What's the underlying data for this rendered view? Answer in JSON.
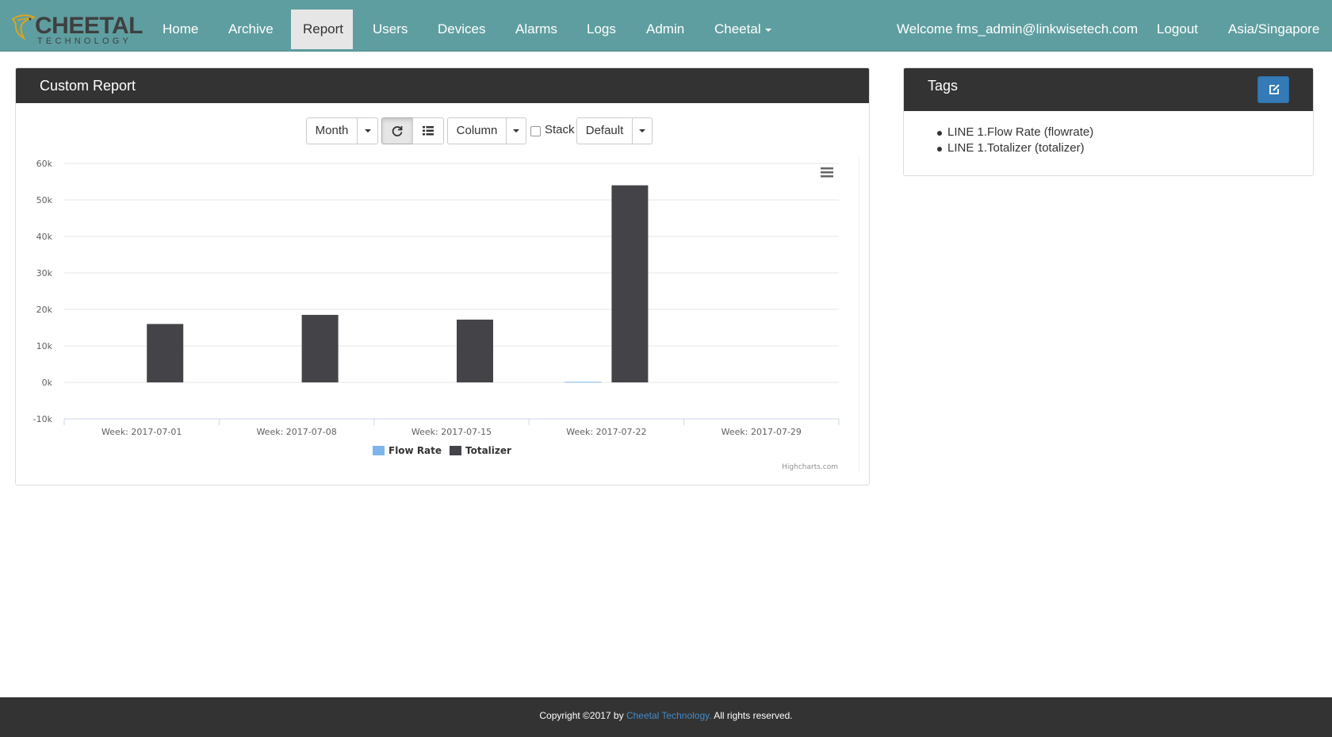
{
  "brand": {
    "name": "CHEETAL",
    "tagline": "TECHNOLOGY"
  },
  "nav": {
    "items": [
      "Home",
      "Archive",
      "Report",
      "Users",
      "Devices",
      "Alarms",
      "Logs",
      "Admin",
      "Cheetal"
    ],
    "active": "Report",
    "welcome": "Welcome fms_admin@linkwisetech.com",
    "logout": "Logout",
    "timezone": "Asia/Singapore"
  },
  "report_panel": {
    "title": "Custom Report",
    "toolbar": {
      "period": "Month",
      "chart_type": "Column",
      "stack_label": "Stack",
      "stack_checked": false,
      "theme": "Default"
    }
  },
  "chart_data": {
    "type": "bar",
    "categories": [
      "Week: 2017-07-01",
      "Week: 2017-07-08",
      "Week: 2017-07-15",
      "Week: 2017-07-22",
      "Week: 2017-07-29"
    ],
    "series": [
      {
        "name": "Flow Rate",
        "color": "#7cb5ec",
        "values": [
          0,
          0,
          0,
          150,
          0
        ]
      },
      {
        "name": "Totalizer",
        "color": "#434348",
        "values": [
          16000,
          18500,
          17200,
          54000,
          0
        ]
      }
    ],
    "ylim": [
      -10000,
      60000
    ],
    "yticks": [
      "60k",
      "50k",
      "40k",
      "30k",
      "20k",
      "10k",
      "0k",
      "-10k"
    ],
    "grid": true,
    "legend": "bottom-center",
    "credits": "Highcharts.com"
  },
  "tags_panel": {
    "title": "Tags",
    "items": [
      "LINE 1.Flow Rate (flowrate)",
      "LINE 1.Totalizer (totalizer)"
    ]
  },
  "footer": {
    "prefix": "Copyright ©2017 by ",
    "company": "Cheetal Technology.",
    "suffix": " All rights reserved."
  },
  "colors": {
    "navbar": "#5f9ea0",
    "panel_heading": "#333333",
    "primary": "#337ab7"
  }
}
